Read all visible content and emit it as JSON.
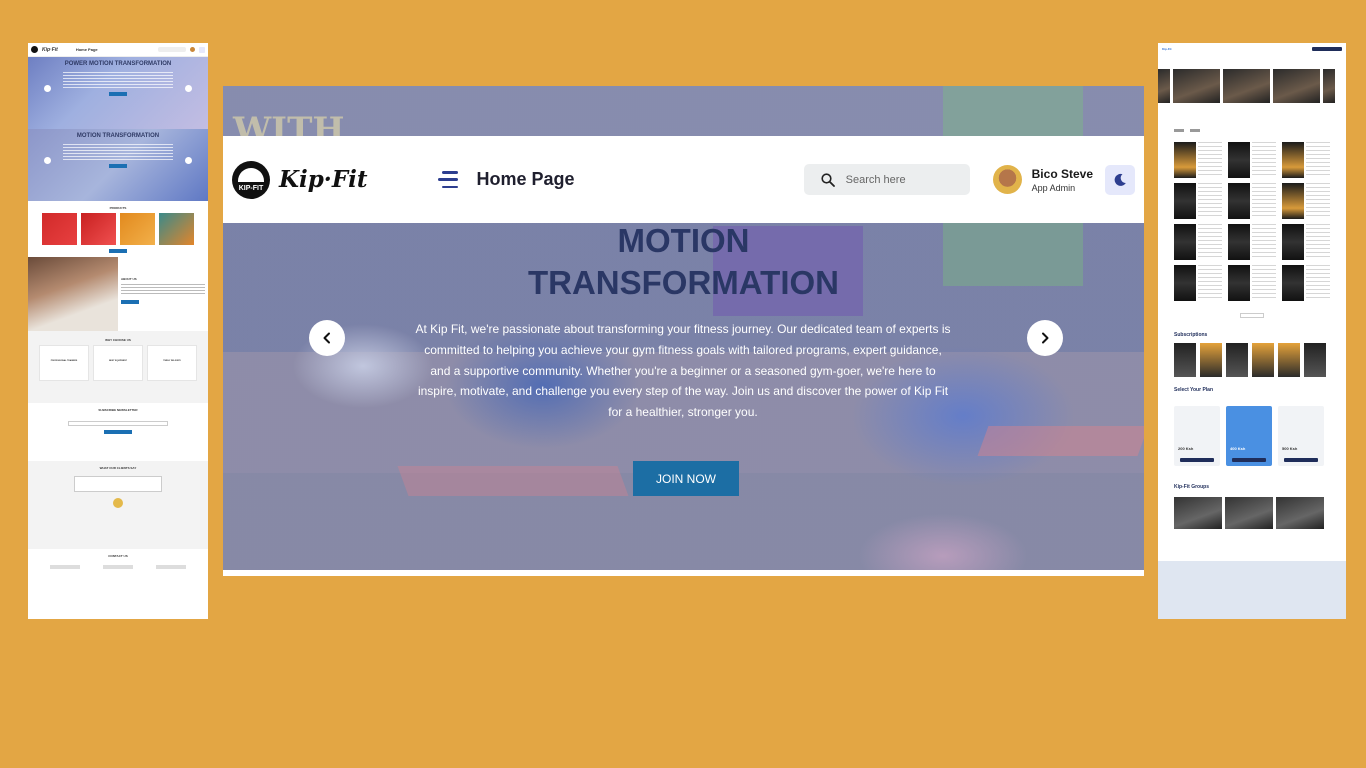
{
  "main": {
    "brand": {
      "name": "Kip·Fit",
      "logo_text": "KIP-FIT"
    },
    "page_title": "Home Page",
    "search": {
      "placeholder": "Search here"
    },
    "user": {
      "name": "Bico Steve",
      "role": "App Admin"
    },
    "hero": {
      "title_line1": "MOTION",
      "title_line2": "TRANSFORMATION",
      "description": "At Kip Fit, we're passionate about transforming your fitness journey. Our dedicated team of experts is committed to helping you achieve your gym fitness goals with tailored programs, expert guidance, and a supportive community. Whether you're a beginner or a seasoned gym-goer, we're here to inspire, motivate, and challenge you every step of the way. Join us and discover the power of Kip Fit for a healthier, stronger you.",
      "cta": "JOIN NOW",
      "background_wall_text": "WITH"
    },
    "icons": [
      "menu-icon",
      "search-icon",
      "moon-icon",
      "chevron-left-icon",
      "chevron-right-icon"
    ]
  },
  "left_preview": {
    "header_title": "Home Page",
    "brand": "Kip·Fit",
    "hero1_title": "POWER MOTION TRANSFORMATION",
    "hero2_title": "MOTION TRANSFORMATION",
    "products_title": "PRODUCTS",
    "about_title": "ABOUT US",
    "why_title": "WHY CHOOSE US",
    "why_cards": [
      "PROFESSIONAL TRAINERS",
      "BEST EQUIPMENT",
      "TIMELY DELIVERY"
    ],
    "newsletter_title": "SUBSCRIBE NEWSLETTER",
    "testimonials_title": "WHAT OUR CLIENTS SAY",
    "footer_title": "CONTACT US"
  },
  "right_preview": {
    "brand": "Kip·Fit",
    "subscriptions_title": "Subscriptions",
    "plans_title": "Select Your Plan",
    "plan_prices": [
      "200 Ksh",
      "400 Ksh",
      "500 Ksh"
    ],
    "groups_title": "Kip-Fit Groups"
  },
  "colors": {
    "page_background": "#E3A644",
    "accent": "#1C6EA4",
    "title_navy": "#2A3765",
    "menu_icon": "#2D3E8F"
  }
}
